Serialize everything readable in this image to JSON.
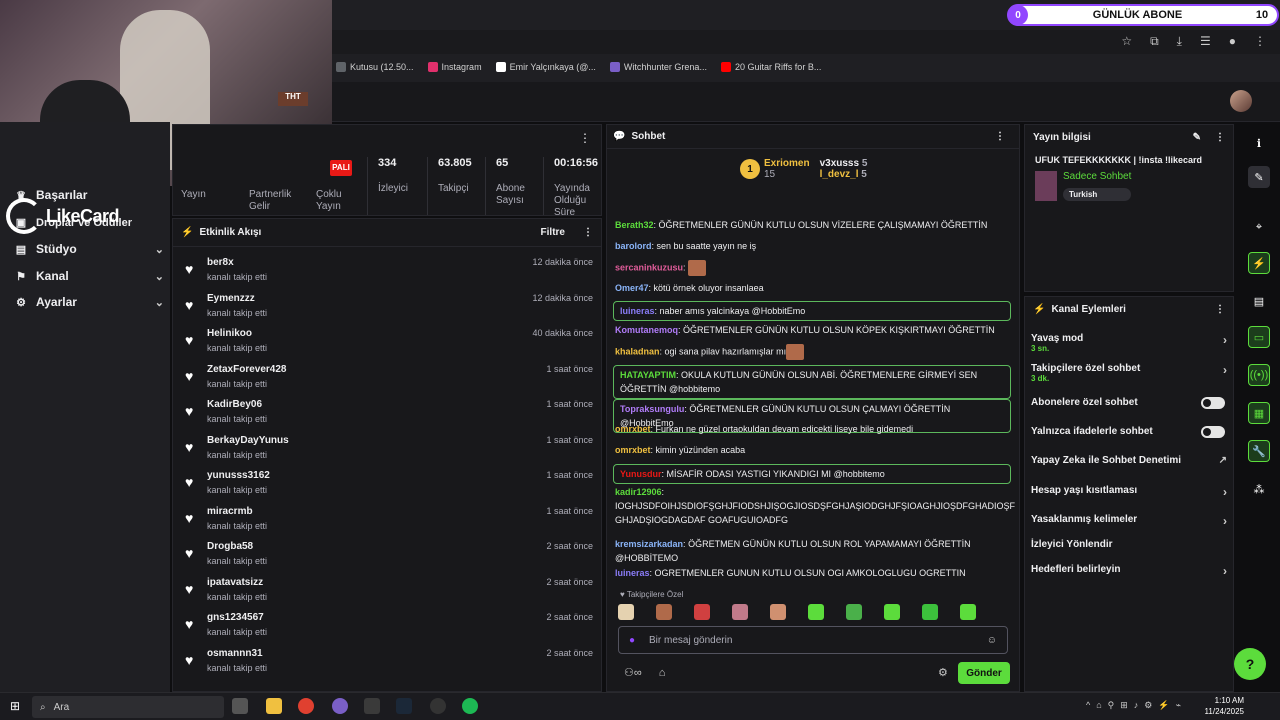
{
  "browser": {
    "bookmarks": [
      "Kutusu (12.50...",
      "Instagram",
      "Emir Yalçınkaya (@...",
      "Witchhunter Grena...",
      "20 Guitar Riffs for B..."
    ],
    "bookmark_colors": [
      "#5f6368",
      "#e1306c",
      "#ffffff",
      "#7a5fc7",
      "#ff0000"
    ]
  },
  "abone_pill": {
    "left": "0",
    "label": "GÜNLÜK ABONE",
    "right": "10"
  },
  "overlay": {
    "logo_text": "LikeCard",
    "sign": "THT"
  },
  "sidebar": {
    "items": [
      {
        "label": "Başarılar"
      },
      {
        "label": "Droplar ve Ödüller"
      },
      {
        "label": "Stüdyo"
      },
      {
        "label": "Kanal"
      },
      {
        "label": "Ayarlar"
      }
    ]
  },
  "stats": {
    "left_labels": [
      "Yayın",
      "Partnerlik Gelir",
      "Çoklu Yayın"
    ],
    "badge": "PALI",
    "columns": [
      {
        "value": "334",
        "label": "İzleyici"
      },
      {
        "value": "63.805",
        "label": "Takipçi"
      },
      {
        "value": "65",
        "label": "Abone Sayısı"
      },
      {
        "value": "00:16:56",
        "label": "Yayında Olduğu Süre"
      }
    ]
  },
  "activity": {
    "title": "Etkinlik Akışı",
    "filter": "Filtre",
    "rows": [
      {
        "name": "ber8x",
        "sub": "kanalı takip etti",
        "time": "12 dakika önce"
      },
      {
        "name": "Eymenzzz",
        "sub": "kanalı takip etti",
        "time": "12 dakika önce"
      },
      {
        "name": "Helinikoo",
        "sub": "kanalı takip etti",
        "time": "40 dakika önce"
      },
      {
        "name": "ZetaxForever428",
        "sub": "kanalı takip etti",
        "time": "1 saat önce"
      },
      {
        "name": "KadirBey06",
        "sub": "kanalı takip etti",
        "time": "1 saat önce"
      },
      {
        "name": "BerkayDayYunus",
        "sub": "kanalı takip etti",
        "time": "1 saat önce"
      },
      {
        "name": "yunusss3162",
        "sub": "kanalı takip etti",
        "time": "1 saat önce"
      },
      {
        "name": "miracrmb",
        "sub": "kanalı takip etti",
        "time": "1 saat önce"
      },
      {
        "name": "Drogba58",
        "sub": "kanalı takip etti",
        "time": "2 saat önce"
      },
      {
        "name": "ipatavatsizz",
        "sub": "kanalı takip etti",
        "time": "2 saat önce"
      },
      {
        "name": "gns1234567",
        "sub": "kanalı takip etti",
        "time": "2 saat önce"
      },
      {
        "name": "osmannn31",
        "sub": "kanalı takip etti",
        "time": "2 saat önce"
      }
    ]
  },
  "chat": {
    "title": "Sohbet",
    "leaders": [
      {
        "rank": "1",
        "name": "Exriomen",
        "score": "15"
      },
      {
        "name": "v3xusss",
        "score": "5"
      },
      {
        "name": "l_devz_l",
        "score": "5"
      }
    ],
    "messages": [
      {
        "user": "Berath32",
        "text": "ÖĞRETMENLER GÜNÜN KUTLU OLSUN VİZELERE ÇALIŞMAMAYI ÖĞRETTİN",
        "color": "#5cdc3c"
      },
      {
        "user": "barolord",
        "text": "sen bu saatte yayın ne iş",
        "color": "#8ab4f8"
      },
      {
        "user": "sercaninkuzusu",
        "text": "",
        "color": "#e05c9a"
      },
      {
        "user": "Omer47",
        "text": "kötü örnek oluyor insanlaea",
        "color": "#8ab4f8"
      },
      {
        "user": "luineras",
        "text": "naber amıs yalcinkaya @HobbitEmo",
        "color": "#8a7cf8"
      },
      {
        "user": "Komutanemoq",
        "text": "ÖĞRETMENLER GÜNÜN KUTLU OLSUN KÖPEK KIŞKIRTMAYI ÖĞRETTİN",
        "color": "#b07cf8"
      },
      {
        "user": "khaladnan",
        "text": "ogi sana pilav hazırlamışlar mı",
        "color": "#f0c040"
      },
      {
        "user": "HATAYAPTIM",
        "text": "OKULA KUTLUN GÜNÜN OLSUN ABİ. ÖĞRETMENLERE GİRMEYİ SEN ÖĞRETTİN @hobbitemo",
        "color": "#5cdc3c"
      },
      {
        "user": "Topraksungulu",
        "text": "ÖĞRETMENLER GÜNÜN KUTLU OLSUN ÇALMAYI ÖĞRETTİN @HobbitEmo",
        "color": "#b07cf8"
      },
      {
        "user": "omrxbet",
        "text": "Furkan ne güzel ortaokuldan devam edicekti liseye bile gidemedi",
        "color": "#f0c040"
      },
      {
        "user": "omrxbet",
        "text": "kimin yüzünden acaba",
        "color": "#f0c040"
      },
      {
        "user": "Yunusdur",
        "text": "MİSAFİR ODASI YASTIGI YIKANDIGI MI @hobbitemo",
        "color": "#e91916"
      },
      {
        "user": "kadir12906",
        "text": "IOGHJSDFOIHJSDIOFŞGHJFIODSHJIŞOGJIOSDŞFGHJAŞIODGHJFŞIOAGHJIOŞDFGHADIOŞF GHJADŞIOGDAGDAF GOAFUGUIOADFG",
        "color": "#5cdc3c"
      },
      {
        "user": "kremsizarkadan",
        "text": "ÖĞRETMEN GÜNÜN KUTLU OLSUN ROL YAPAMAMAYI ÖĞRETTİN @HOBBİTEMO",
        "color": "#8ab4f8"
      },
      {
        "user": "luineras",
        "text": "OGRETMENLER GUNUN KUTLU OLSUN OGI AMKOLOGLUGU OGRETTIN",
        "color": "#8a7cf8"
      }
    ],
    "follower_only": "Takipçilere Özel",
    "placeholder": "Bir mesaj gönderin",
    "send": "Gönder"
  },
  "stream_info": {
    "title": "Yayın bilgisi",
    "stream_title": "UFUK TEFEKKKKKKK | !insta !likecard",
    "category": "Sadece Sohbet",
    "tag": "Turkish"
  },
  "channel_actions": {
    "title": "Kanal Eylemleri",
    "rows": [
      {
        "label": "Yavaş mod",
        "sub": "3 sn.",
        "kind": "chevron"
      },
      {
        "label": "Takipçilere özel sohbet",
        "sub": "3 dk.",
        "kind": "chevron"
      },
      {
        "label": "Abonelere özel sohbet",
        "sub": "",
        "kind": "toggle"
      },
      {
        "label": "Yalnızca ifadelerle sohbet",
        "sub": "",
        "kind": "toggle"
      },
      {
        "label": "Yapay Zeka ile Sohbet Denetimi",
        "sub": "",
        "kind": "external"
      },
      {
        "label": "Hesap yaşı kısıtlaması",
        "sub": "",
        "kind": "chevron"
      },
      {
        "label": "Yasaklanmış kelimeler",
        "sub": "",
        "kind": "chevron"
      },
      {
        "label": "İzleyici Yönlendir",
        "sub": "",
        "kind": "none"
      },
      {
        "label": "Hedefleri belirleyin",
        "sub": "",
        "kind": "chevron"
      }
    ]
  },
  "taskbar": {
    "search": "Ara",
    "time": "1:10 AM",
    "date": "11/24/2025"
  },
  "colors": {
    "accent": "#5cdc3c",
    "purple": "#9147ff",
    "bg": "#18181b"
  }
}
